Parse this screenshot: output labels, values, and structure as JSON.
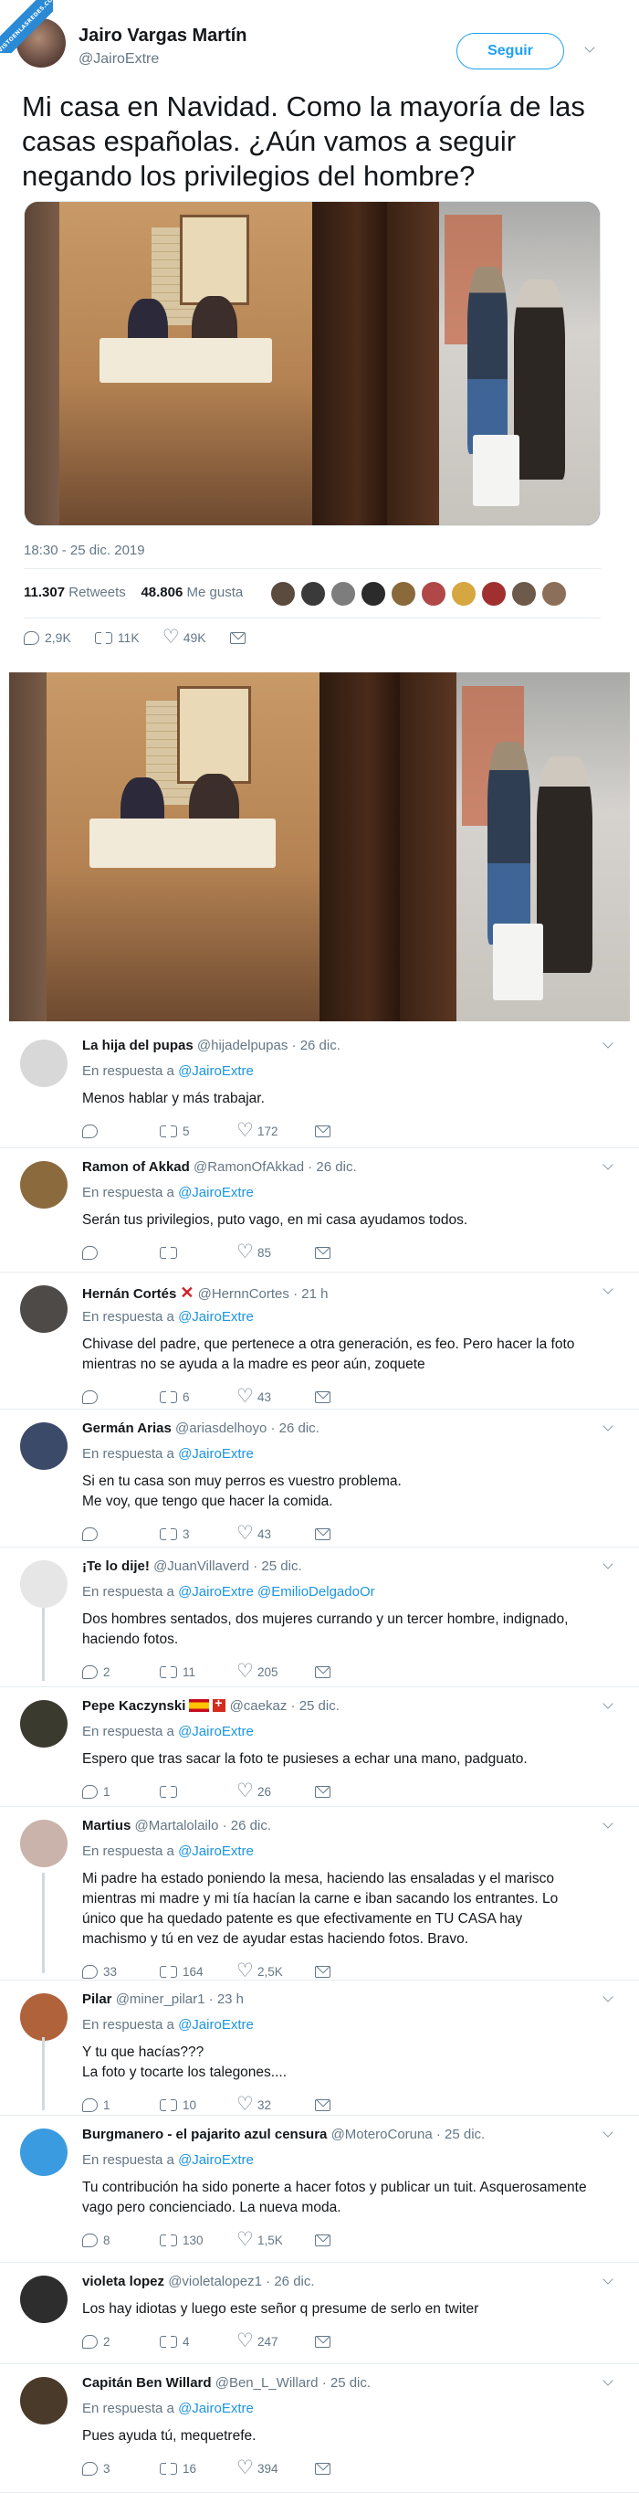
{
  "watermark": "VISTOENLASREDES.COM",
  "tweet": {
    "name": "Jairo Vargas Martín",
    "handle": "@JairoExtre",
    "follow_label": "Seguir",
    "text": "Mi casa en Navidad. Como la mayoría de las casas españolas. ¿Aún vamos a seguir negando los privilegios del hombre?",
    "time": "18:30 - 25 dic. 2019",
    "retweets": "11.307",
    "retweets_label": "Retweets",
    "likes": "48.806",
    "likes_label": "Me gusta",
    "actions": {
      "replies": "2,9K",
      "retweets": "11K",
      "likes": "49K"
    }
  },
  "liker_colors": [
    "#5b4a3e",
    "#3a3a3a",
    "#7d7d7d",
    "#2b2b2b",
    "#8a6a3a",
    "#b04848",
    "#d6a640",
    "#a03030",
    "#6d5a4a",
    "#8c6f5a"
  ],
  "replies": [
    {
      "name": "La hija del pupas",
      "handle": "@hijadelpupas",
      "time": "26 dic.",
      "respuesta": "En respuesta a",
      "to": "@JairoExtre",
      "text": [
        "Menos hablar y más trabajar."
      ],
      "rt": "5",
      "like": "172",
      "reply": "",
      "avatar": "#d8d8d8"
    },
    {
      "name": "Ramon of Akkad",
      "handle": "@RamonOfAkkad",
      "time": "26 dic.",
      "respuesta": "En respuesta a",
      "to": "@JairoExtre",
      "text": [
        "Serán tus privilegios, puto vago, en mi casa ayudamos todos."
      ],
      "rt": "",
      "like": "85",
      "reply": "",
      "avatar": "#8b6a3e"
    },
    {
      "name": "Hernán Cortés",
      "handle": "@HernnCortes",
      "time": "21 h",
      "respuesta": "En respuesta a",
      "to": "@JairoExtre",
      "text": [
        "Chivase del padre, que pertenece a otra generación, es feo. Pero hacer la foto",
        "mientras no se ayuda a la madre es peor aún, zoquete"
      ],
      "rt": "6",
      "like": "43",
      "reply": "",
      "avatar": "#4d4a48"
    },
    {
      "name": "Germán Arias",
      "handle": "@ariasdelhoyo",
      "time": "26 dic.",
      "respuesta": "En respuesta a",
      "to": "@JairoExtre",
      "text": [
        "Si en tu casa son muy perros es vuestro problema.",
        "Me voy, que tengo que hacer la comida."
      ],
      "rt": "3",
      "like": "43",
      "reply": "",
      "avatar": "#3c4a6a"
    },
    {
      "name": "¡Te lo dije!",
      "handle": "@JuanVillaverd",
      "time": "25 dic.",
      "respuesta": "En respuesta a",
      "to": "@JairoExtre @EmilioDelgadoOr",
      "text": [
        "Dos hombres sentados, dos mujeres currando y un tercer hombre, indignado,",
        "haciendo fotos."
      ],
      "rt": "11",
      "like": "205",
      "reply": "2",
      "avatar": "#e6e6e6"
    },
    {
      "name": "Pepe Kaczynski",
      "handle": "@caekaz",
      "time": "25 dic.",
      "respuesta": "En respuesta a",
      "to": "@JairoExtre",
      "text": [
        "Espero que tras sacar la foto te pusieses a echar una mano, padguato."
      ],
      "rt": "",
      "like": "26",
      "reply": "1",
      "avatar": "#3a3a2e"
    },
    {
      "name": "Martius",
      "handle": "@Martalolailo",
      "time": "26 dic.",
      "respuesta": "En respuesta a",
      "to": "@JairoExtre",
      "text": [
        "Mi padre ha estado poniendo la mesa, haciendo las ensaladas y el marisco",
        "mientras mi madre y mi tía hacían la carne e iban sacando los entrantes. Lo",
        "único que ha quedado patente es que efectivamente en TU CASA hay",
        "machismo y tú en vez de ayudar estas haciendo fotos. Bravo."
      ],
      "rt": "164",
      "like": "2,5K",
      "reply": "33",
      "avatar": "#c9b3aa"
    },
    {
      "name": "Pilar",
      "handle": "@miner_pilar1",
      "time": "23 h",
      "respuesta": "En respuesta a",
      "to": "@JairoExtre",
      "text": [
        "Y tu que hacías???",
        "La foto y tocarte los talegones...."
      ],
      "rt": "10",
      "like": "32",
      "reply": "1",
      "avatar": "#b0623a"
    },
    {
      "name": "Burgmanero - el pajarito azul censura",
      "handle": "@MoteroCoruna",
      "time": "25 dic.",
      "respuesta": "En respuesta a",
      "to": "@JairoExtre",
      "text": [
        "Tu contribución ha sido ponerte a hacer fotos y publicar un tuit. Asquerosamente",
        "vago pero concienciado. La nueva moda."
      ],
      "rt": "130",
      "like": "1,5K",
      "reply": "8",
      "avatar": "#3b9be0"
    },
    {
      "name": "violeta lopez",
      "handle": "@violetalopez1",
      "time": "26 dic.",
      "respuesta": "",
      "to": "",
      "text": [
        "Los hay idiotas y luego este señor q presume de serlo en twiter"
      ],
      "rt": "4",
      "like": "247",
      "reply": "2",
      "avatar": "#2d2d2d"
    },
    {
      "name": "Capitán Ben Willard",
      "handle": "@Ben_L_Willard",
      "time": "25 dic.",
      "respuesta": "En respuesta a",
      "to": "@JairoExtre",
      "text": [
        "Pues ayuda tú, mequetrefe."
      ],
      "rt": "16",
      "like": "394",
      "reply": "3",
      "avatar": "#4a3a2a"
    }
  ]
}
